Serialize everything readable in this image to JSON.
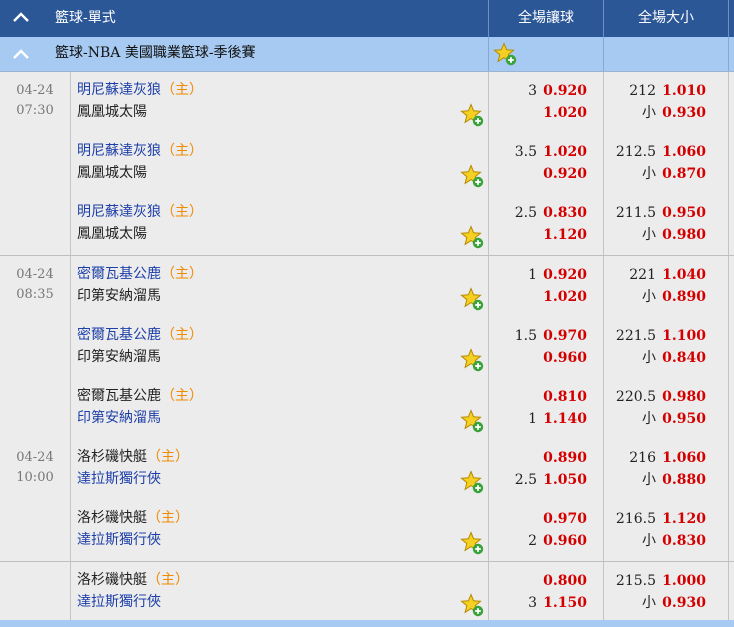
{
  "header": {
    "title": "籃球-單式",
    "col_handicap": "全場讓球",
    "col_ou": "全場大小"
  },
  "league": {
    "name": "籃球-NBA 美國職業籃球-季後賽"
  },
  "labels": {
    "home": "（主）",
    "under": "小"
  },
  "colors": {
    "header_bg": "#2b5797",
    "league_bg": "#a7caf2",
    "odds": "#d40000",
    "fav_team": "#1e3fa8",
    "home_tag": "#f08a00"
  },
  "rows": [
    {
      "date": "04-24",
      "time": "07:30",
      "team1": "明尼蘇達灰狼",
      "team2": "鳳凰城太陽",
      "home": 1,
      "fav": 1,
      "hdp_line": "3",
      "hdp_odds1": "0.920",
      "hdp_odds2": "1.020",
      "ou_line": "212",
      "ou_over": "1.010",
      "ou_under": "0.930"
    },
    {
      "date": "",
      "time": "",
      "team1": "明尼蘇達灰狼",
      "team2": "鳳凰城太陽",
      "home": 1,
      "fav": 1,
      "hdp_line": "3.5",
      "hdp_odds1": "1.020",
      "hdp_odds2": "0.920",
      "ou_line": "212.5",
      "ou_over": "1.060",
      "ou_under": "0.870"
    },
    {
      "date": "",
      "time": "",
      "team1": "明尼蘇達灰狼",
      "team2": "鳳凰城太陽",
      "home": 1,
      "fav": 1,
      "hdp_line": "2.5",
      "hdp_odds1": "0.830",
      "hdp_odds2": "1.120",
      "ou_line": "211.5",
      "ou_over": "0.950",
      "ou_under": "0.980"
    },
    {
      "date": "04-24",
      "time": "08:35",
      "team1": "密爾瓦基公鹿",
      "team2": "印第安納溜馬",
      "home": 1,
      "fav": 1,
      "hdp_line": "1",
      "hdp_odds1": "0.920",
      "hdp_odds2": "1.020",
      "ou_line": "221",
      "ou_over": "1.040",
      "ou_under": "0.890"
    },
    {
      "date": "",
      "time": "",
      "team1": "密爾瓦基公鹿",
      "team2": "印第安納溜馬",
      "home": 1,
      "fav": 1,
      "hdp_line": "1.5",
      "hdp_odds1": "0.970",
      "hdp_odds2": "0.960",
      "ou_line": "221.5",
      "ou_over": "1.100",
      "ou_under": "0.840"
    },
    {
      "date": "",
      "time": "",
      "team1": "密爾瓦基公鹿",
      "team2": "印第安納溜馬",
      "home": 1,
      "fav": 2,
      "hdp_line": "1",
      "hdp_odds1": "0.810",
      "hdp_odds2": "1.140",
      "ou_line": "220.5",
      "ou_over": "0.980",
      "ou_under": "0.950"
    },
    {
      "date": "04-24",
      "time": "10:00",
      "team1": "洛杉磯快艇",
      "team2": "達拉斯獨行俠",
      "home": 1,
      "fav": 2,
      "hdp_line": "2.5",
      "hdp_odds1": "0.890",
      "hdp_odds2": "1.050",
      "ou_line": "216",
      "ou_over": "1.060",
      "ou_under": "0.880"
    },
    {
      "date": "",
      "time": "",
      "team1": "洛杉磯快艇",
      "team2": "達拉斯獨行俠",
      "home": 1,
      "fav": 2,
      "hdp_line": "2",
      "hdp_odds1": "0.970",
      "hdp_odds2": "0.960",
      "ou_line": "216.5",
      "ou_over": "1.120",
      "ou_under": "0.830"
    },
    {
      "date": "",
      "time": "",
      "team1": "洛杉磯快艇",
      "team2": "達拉斯獨行俠",
      "home": 1,
      "fav": 2,
      "hdp_line": "3",
      "hdp_odds1": "0.800",
      "hdp_odds2": "1.150",
      "ou_line": "215.5",
      "ou_over": "1.000",
      "ou_under": "0.930"
    }
  ]
}
